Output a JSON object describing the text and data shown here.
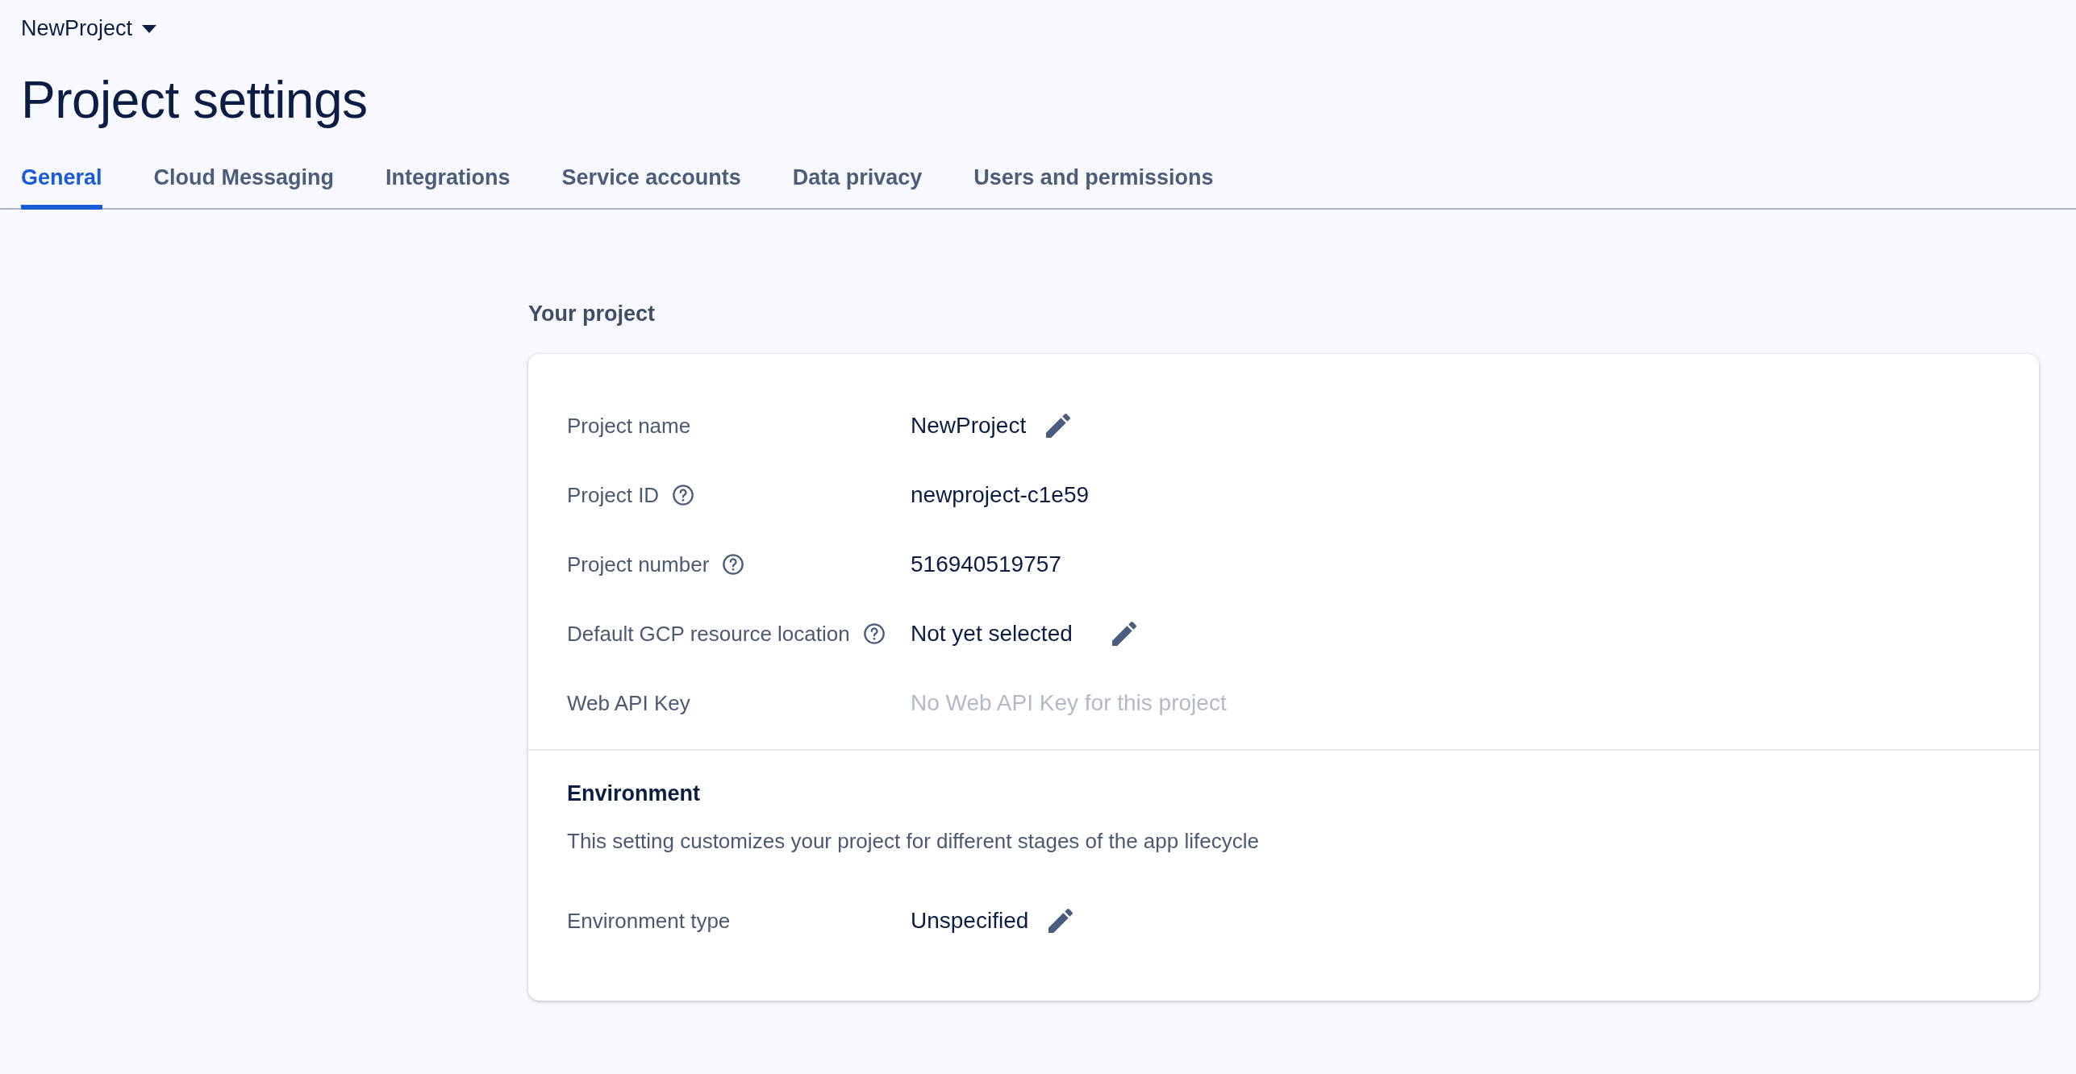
{
  "project_switcher": {
    "label": "NewProject"
  },
  "title": "Project settings",
  "tabs": [
    {
      "label": "General",
      "selected": true
    },
    {
      "label": "Cloud Messaging",
      "selected": false
    },
    {
      "label": "Integrations",
      "selected": false
    },
    {
      "label": "Service accounts",
      "selected": false
    },
    {
      "label": "Data privacy",
      "selected": false
    },
    {
      "label": "Users and permissions",
      "selected": false
    }
  ],
  "section_title": "Your project",
  "fields": [
    {
      "label": "Project name",
      "help": false,
      "value": "NewProject",
      "muted": false,
      "editable": true
    },
    {
      "label": "Project ID",
      "help": true,
      "value": "newproject-c1e59",
      "muted": false,
      "editable": false
    },
    {
      "label": "Project number",
      "help": true,
      "value": "516940519757",
      "muted": false,
      "editable": false
    },
    {
      "label": "Default GCP resource location",
      "help": true,
      "value": "Not yet selected",
      "muted": false,
      "editable": true
    },
    {
      "label": "Web API Key",
      "help": false,
      "value": "No Web API Key for this project",
      "muted": true,
      "editable": false
    }
  ],
  "environment": {
    "title": "Environment",
    "description": "This setting customizes your project for different stages of the app lifecycle",
    "fields": [
      {
        "label": "Environment type",
        "help": false,
        "value": "Unspecified",
        "muted": false,
        "editable": true
      }
    ]
  }
}
